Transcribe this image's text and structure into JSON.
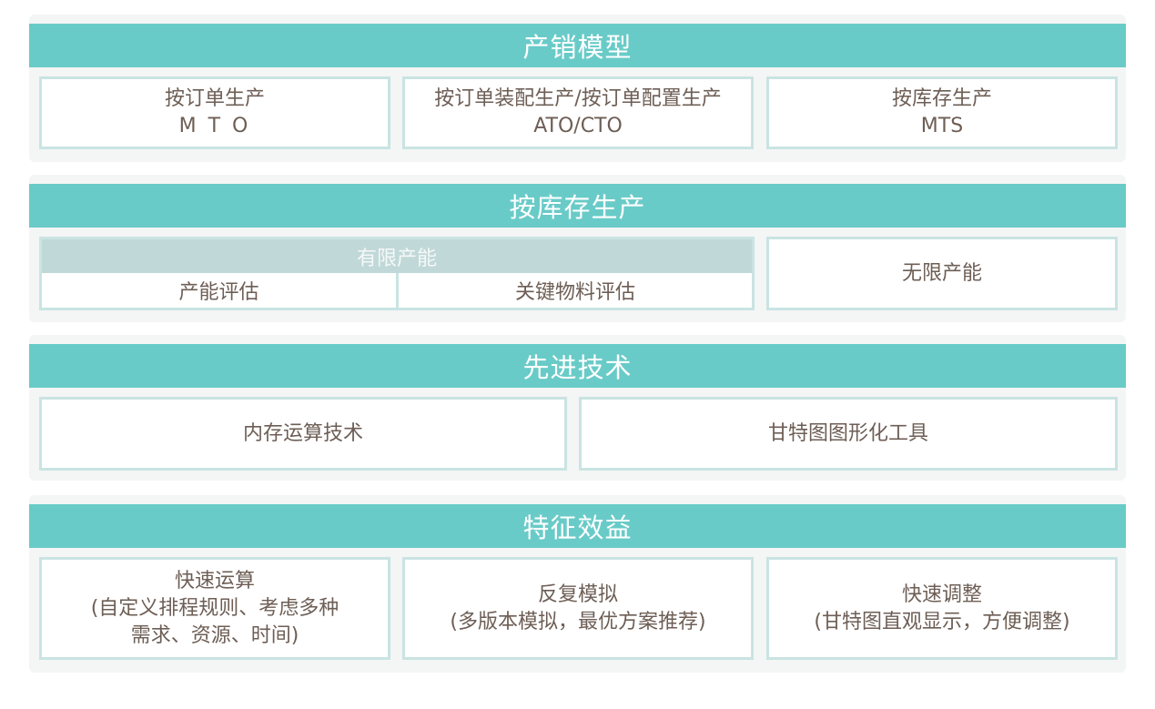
{
  "sections": [
    {
      "title": "产销模型",
      "boxes": [
        {
          "line1": "按订单生产",
          "line2": "M T O"
        },
        {
          "line1": "按订单装配生产/按订单配置生产",
          "line2": "ATO/CTO"
        },
        {
          "line1": "按库存生产",
          "line2": "MTS"
        }
      ]
    },
    {
      "title": "按库存生产",
      "group": {
        "title": "有限产能",
        "cells": [
          "产能评估",
          "关键物料评估"
        ]
      },
      "box": "无限产能"
    },
    {
      "title": "先进技术",
      "boxes": [
        "内存运算技术",
        "甘特图图形化工具"
      ]
    },
    {
      "title": "特征效益",
      "boxes": [
        {
          "lines": [
            "快速运算",
            "(自定义排程规则、考虑多种",
            "需求、资源、时间)"
          ]
        },
        {
          "lines": [
            "反复模拟",
            "(多版本模拟，最优方案推荐)"
          ]
        },
        {
          "lines": [
            "快速调整",
            "(甘特图直观显示，方便调整)"
          ]
        }
      ]
    }
  ]
}
